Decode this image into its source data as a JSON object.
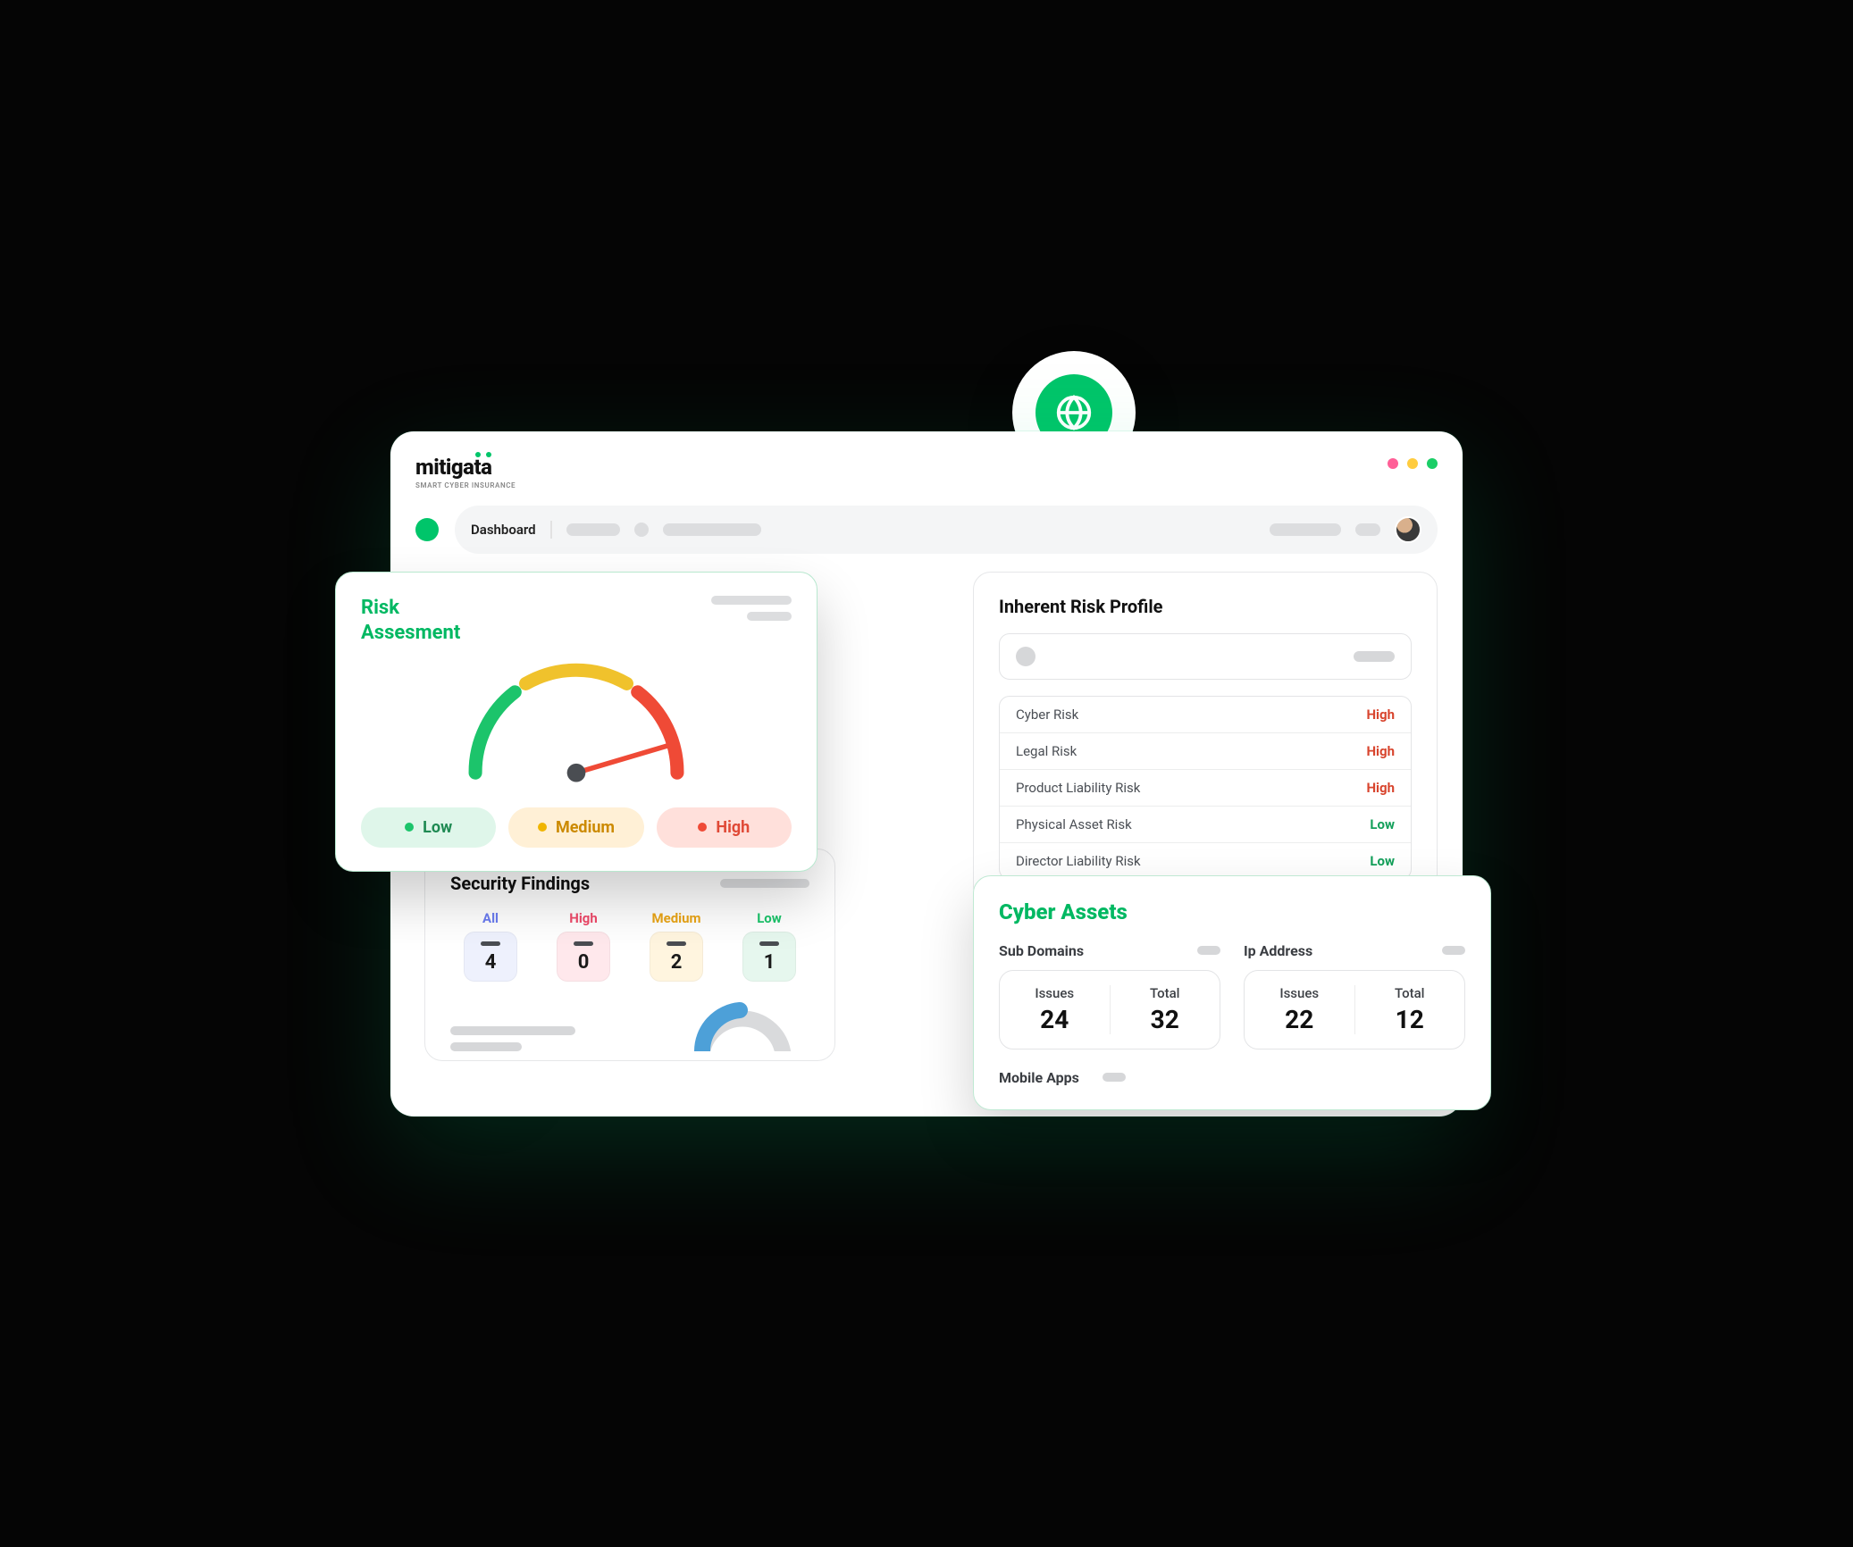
{
  "brand": {
    "name": "mitigata",
    "tagline": "SMART CYBER INSURANCE"
  },
  "toolbar": {
    "crumb": "Dashboard"
  },
  "colors": {
    "accent": "#00c56a",
    "high": "#e04a37",
    "medium": "#eaa516",
    "low": "#1cc46b"
  },
  "risk_assessment": {
    "title_line1": "Risk",
    "title_line2": "Assesment",
    "legend": {
      "low": "Low",
      "medium": "Medium",
      "high": "High"
    },
    "gauge": {
      "needle_level": "high"
    }
  },
  "inherent_risk_profile": {
    "title": "Inherent Risk Profile",
    "rows": [
      {
        "label": "Cyber Risk",
        "level": "High"
      },
      {
        "label": "Legal Risk",
        "level": "High"
      },
      {
        "label": "Product Liability Risk",
        "level": "High"
      },
      {
        "label": "Physical Asset Risk",
        "level": "Low"
      },
      {
        "label": "Director Liability Risk",
        "level": "Low"
      }
    ]
  },
  "security_findings": {
    "title": "Security Findings",
    "tabs": [
      {
        "key": "all",
        "label": "All",
        "count": "4"
      },
      {
        "key": "high",
        "label": "High",
        "count": "0"
      },
      {
        "key": "medium",
        "label": "Medium",
        "count": "2"
      },
      {
        "key": "low",
        "label": "Low",
        "count": "1"
      }
    ]
  },
  "cyber_assets": {
    "title": "Cyber Assets",
    "sub_domains": {
      "title": "Sub Domains",
      "issues_label": "Issues",
      "issues_value": "24",
      "total_label": "Total",
      "total_value": "32"
    },
    "ip_address": {
      "title": "Ip Address",
      "issues_label": "Issues",
      "issues_value": "22",
      "total_label": "Total",
      "total_value": "12"
    },
    "mobile_apps": {
      "title": "Mobile Apps"
    }
  }
}
